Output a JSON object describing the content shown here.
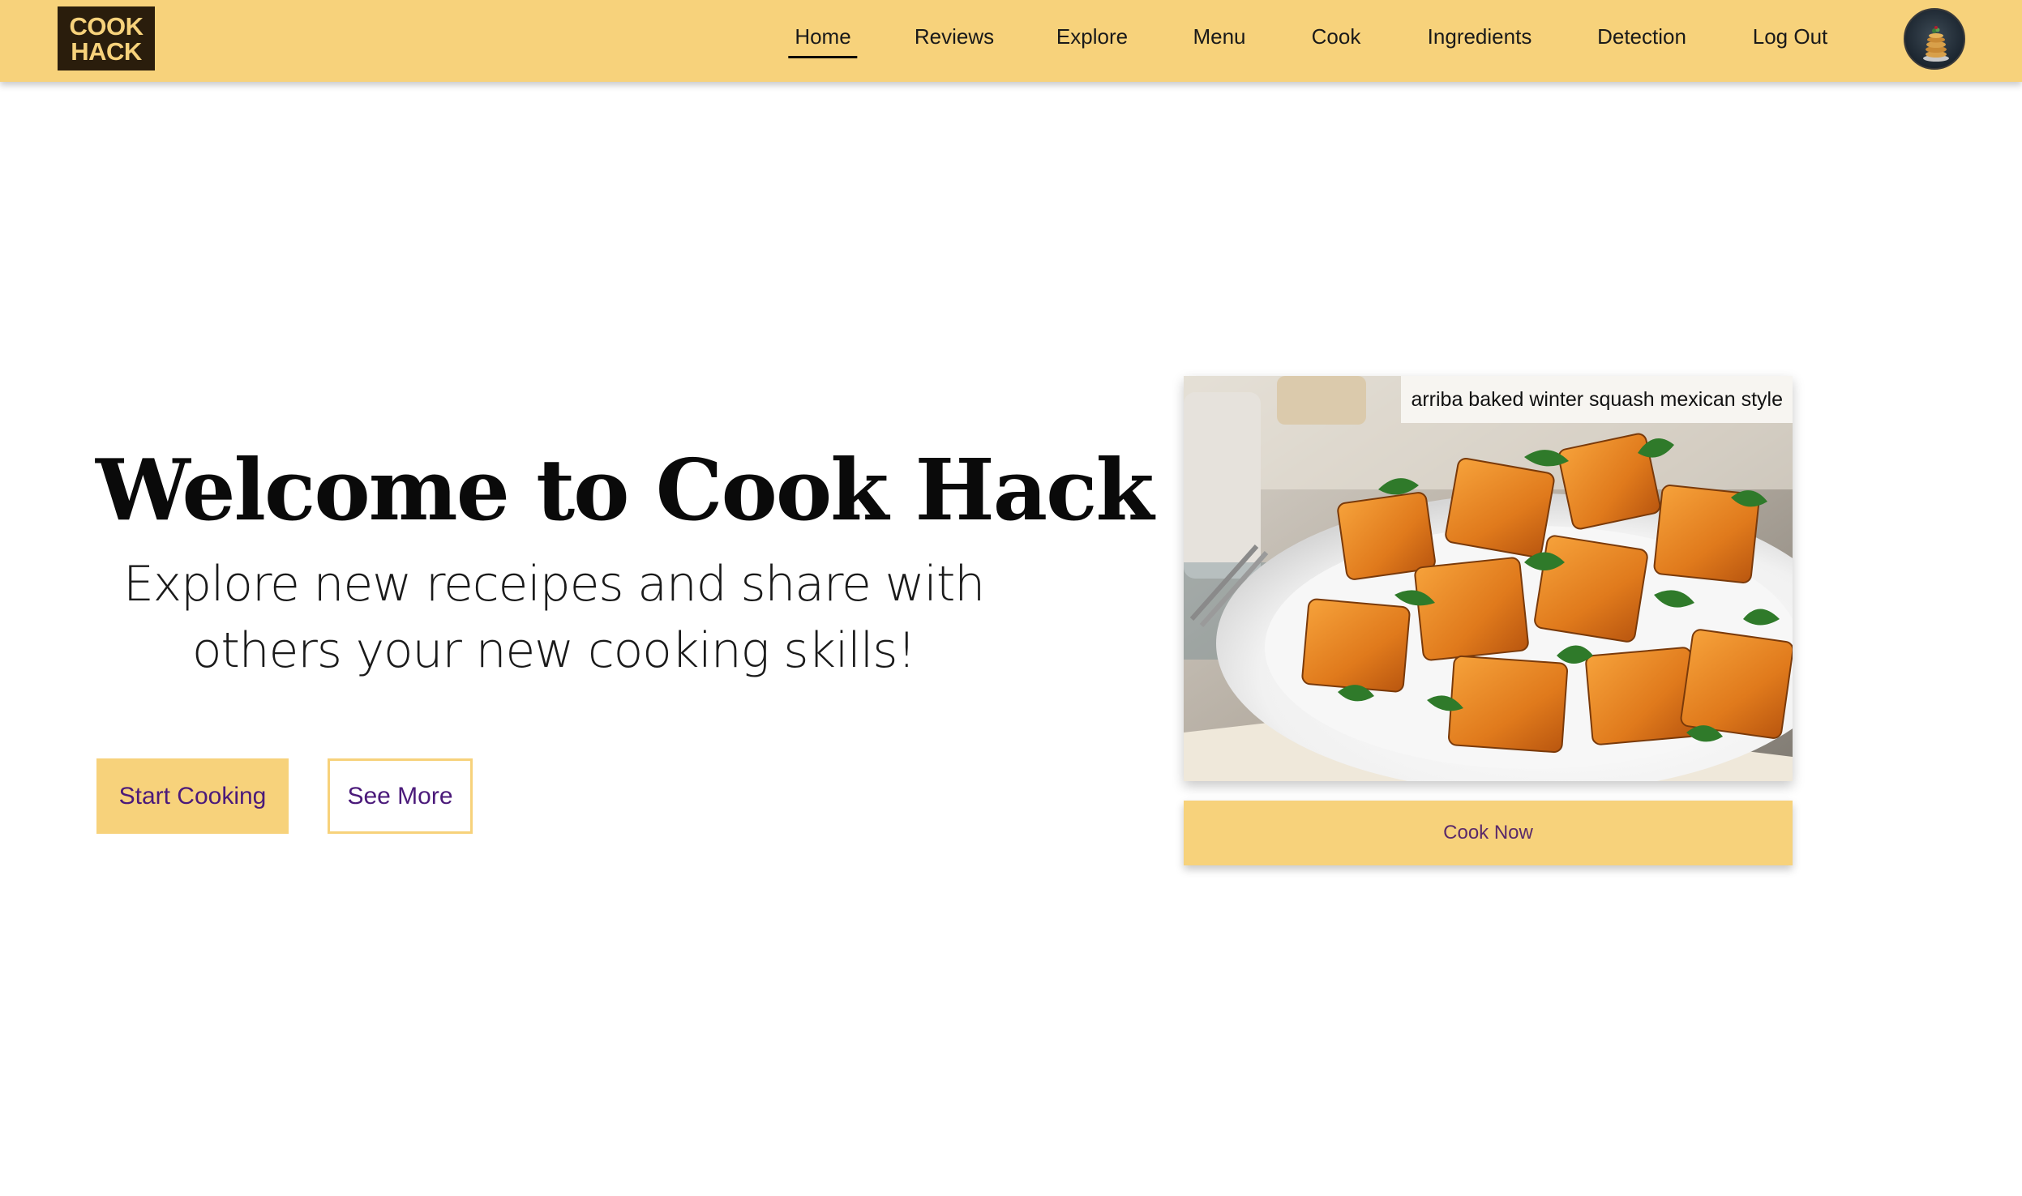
{
  "brand": {
    "logo_line1": "COOK",
    "logo_line2": "HACK"
  },
  "nav": {
    "items": [
      {
        "label": "Home",
        "active": true
      },
      {
        "label": "Reviews"
      },
      {
        "label": "Explore"
      },
      {
        "label": "Menu"
      },
      {
        "label": "Cook"
      },
      {
        "label": "Ingredients"
      },
      {
        "label": "Detection"
      },
      {
        "label": "Log Out"
      }
    ]
  },
  "hero": {
    "title": "Welcome to Cook Hack",
    "subtitle_line1": "Explore new receipes and share with",
    "subtitle_line2": "others your new cooking skills!",
    "primary_button": "Start Cooking",
    "secondary_button": "See More"
  },
  "featured": {
    "caption": "arriba baked winter squash mexican style",
    "cook_button": "Cook Now"
  },
  "colors": {
    "accent": "#f7d27b",
    "logo_bg": "#2a1d0c",
    "button_text": "#4b1a7a"
  }
}
